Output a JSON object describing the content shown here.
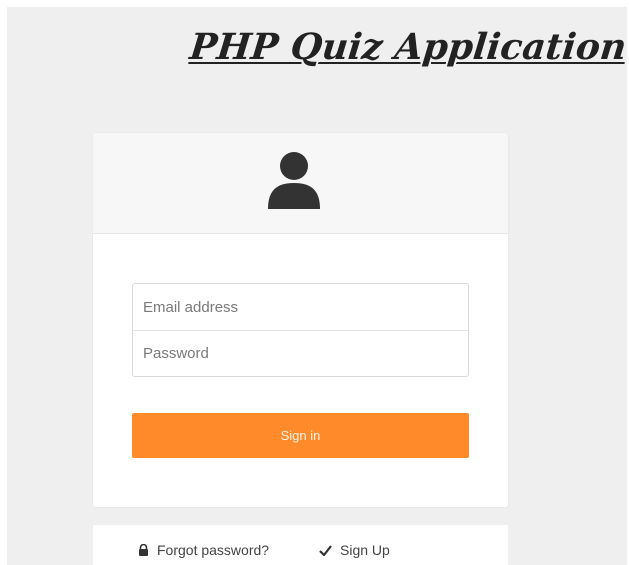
{
  "app": {
    "title": "PHP Quiz Application"
  },
  "login_card": {
    "header_icon": "user-icon",
    "email_placeholder": "Email address",
    "password_placeholder": "Password",
    "signin_label": "Sign in"
  },
  "footer": {
    "forgot_icon": "lock-icon",
    "forgot_label": "Forgot password?",
    "signup_icon": "check-icon",
    "signup_label": "Sign Up"
  },
  "colors": {
    "accent": "#ff8a2a",
    "background": "#efefef",
    "icon": "#333333"
  }
}
